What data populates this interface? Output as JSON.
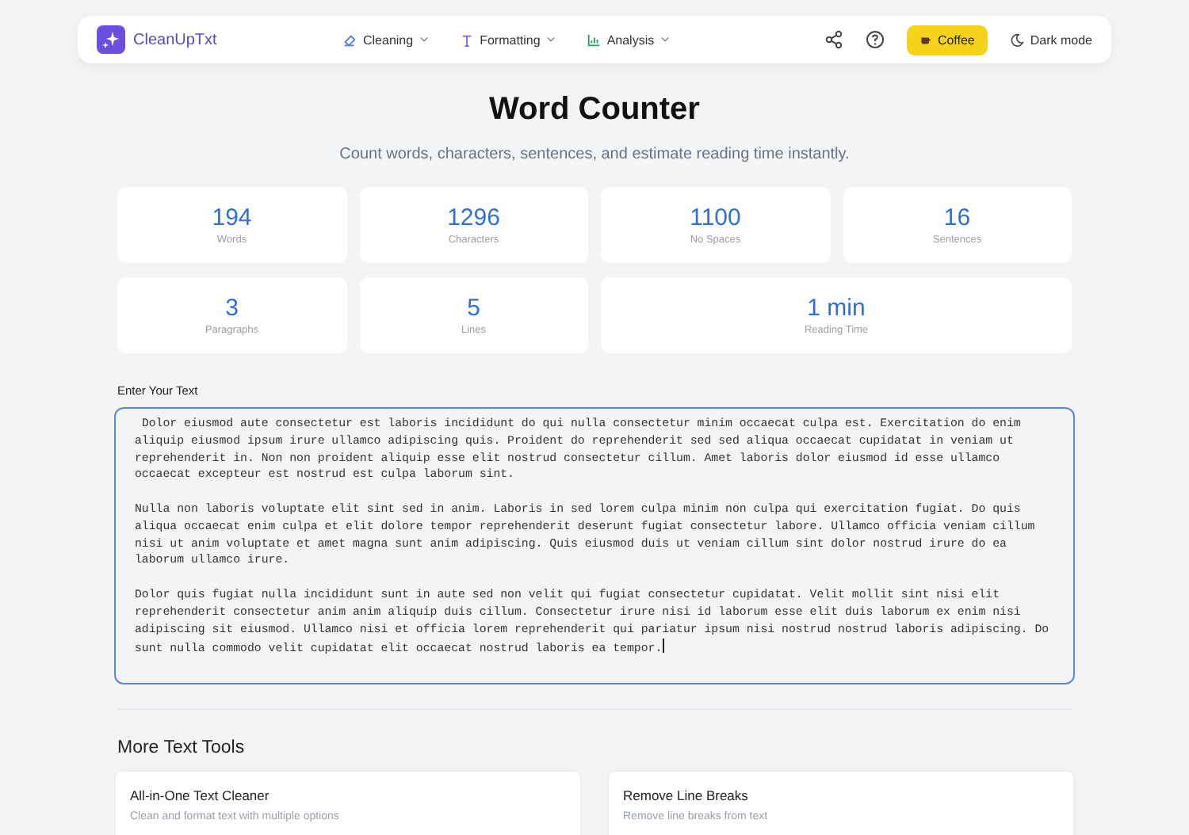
{
  "header": {
    "logo": "CleanUpTxt",
    "nav": [
      {
        "label": "Cleaning",
        "kind": "cleaning"
      },
      {
        "label": "Formatting",
        "kind": "formatting"
      },
      {
        "label": "Analysis",
        "kind": "analysis"
      }
    ],
    "coffee_button": "Coffee",
    "dark_mode_button": "Dark mode"
  },
  "title": "Word Counter",
  "subtitle": "Count words, characters, sentences, and estimate reading time instantly.",
  "stats": [
    {
      "value": "194",
      "label": "Words",
      "kind": "single"
    },
    {
      "value": "1296",
      "label": "Characters",
      "kind": "single"
    },
    {
      "value": "1100",
      "label": "No Spaces",
      "kind": "single"
    },
    {
      "value": "16",
      "label": "Sentences",
      "kind": "single"
    },
    {
      "value": "3",
      "label": "Paragraphs",
      "kind": "single"
    },
    {
      "value": "5",
      "label": "Lines",
      "kind": "single"
    },
    {
      "value": "1 min",
      "label": "Reading Time",
      "kind": "wide"
    }
  ],
  "input": {
    "label": "Enter Your Text",
    "value": " Dolor eiusmod aute consectetur est laboris incididunt do qui nulla consectetur minim occaecat culpa est. Exercitation do enim aliquip eiusmod ipsum irure ullamco adipiscing quis. Proident do reprehenderit sed sed aliqua occaecat cupidatat in veniam ut reprehenderit in. Non non proident aliquip esse elit nostrud consectetur cillum. Amet laboris dolor eiusmod id esse ullamco occaecat excepteur est nostrud est culpa laborum sint.\n\nNulla non laboris voluptate elit sint sed in anim. Laboris in sed lorem culpa minim non culpa qui exercitation fugiat. Do quis aliqua occaecat enim culpa et elit dolore tempor reprehenderit deserunt fugiat consectetur labore. Ullamco officia veniam cillum nisi ut anim voluptate et amet magna sunt anim adipiscing. Quis eiusmod duis ut veniam cillum sint dolor nostrud irure do ea laborum ullamco irure.\n\nDolor quis fugiat nulla incididunt sunt in aute sed non velit qui fugiat consectetur cupidatat. Velit mollit sint nisi elit reprehenderit consectetur anim anim aliquip duis cillum. Consectetur irure nisi id laborum esse elit duis laborum ex enim nisi adipiscing sit eiusmod. Ullamco nisi et officia lorem reprehenderit qui pariatur ipsum nisi nostrud nostrud laboris adipiscing. Do sunt nulla commodo velit cupidatat elit occaecat nostrud laboris ea tempor.",
    "focused": true
  },
  "more_tools": {
    "heading": "More Text Tools",
    "tools": [
      {
        "title": "All-in-One Text Cleaner",
        "description": "Clean and format text with multiple options"
      },
      {
        "title": "Remove Line Breaks",
        "description": "Remove line breaks from text"
      }
    ]
  }
}
